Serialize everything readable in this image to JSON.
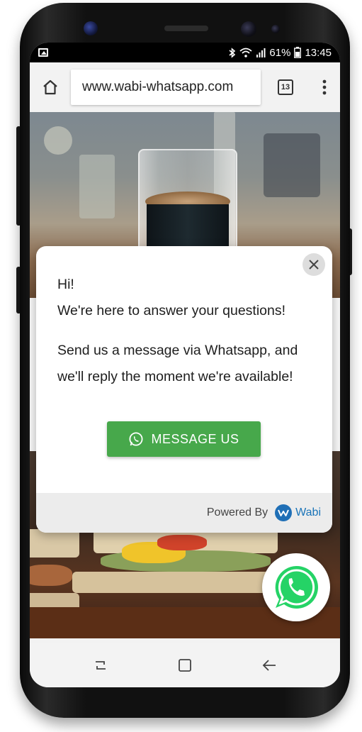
{
  "status_bar": {
    "battery": "61%",
    "time": "13:45",
    "icons": [
      "image-icon",
      "bluetooth-icon",
      "wifi-icon",
      "signal-icon",
      "battery-icon"
    ]
  },
  "browser": {
    "url": "www.wabi-whatsapp.com",
    "tab_count": "13",
    "icons": [
      "home-icon",
      "tabs-icon",
      "more-vert-icon"
    ]
  },
  "popup": {
    "line1": "Hi!",
    "line2": "We're here to answer your questions!",
    "line3": "Send us a message via Whatsapp, and",
    "line4": "we'll reply the moment we're available!",
    "button_label": "MESSAGE US",
    "powered_by": "Powered By",
    "brand": "Wabi"
  },
  "colors": {
    "button_green": "#47a84b",
    "whatsapp_green": "#25d366",
    "wabi_blue": "#1f6fb6"
  },
  "nav": {
    "icons": [
      "recents-icon",
      "home-square-icon",
      "back-arrow-icon"
    ]
  }
}
